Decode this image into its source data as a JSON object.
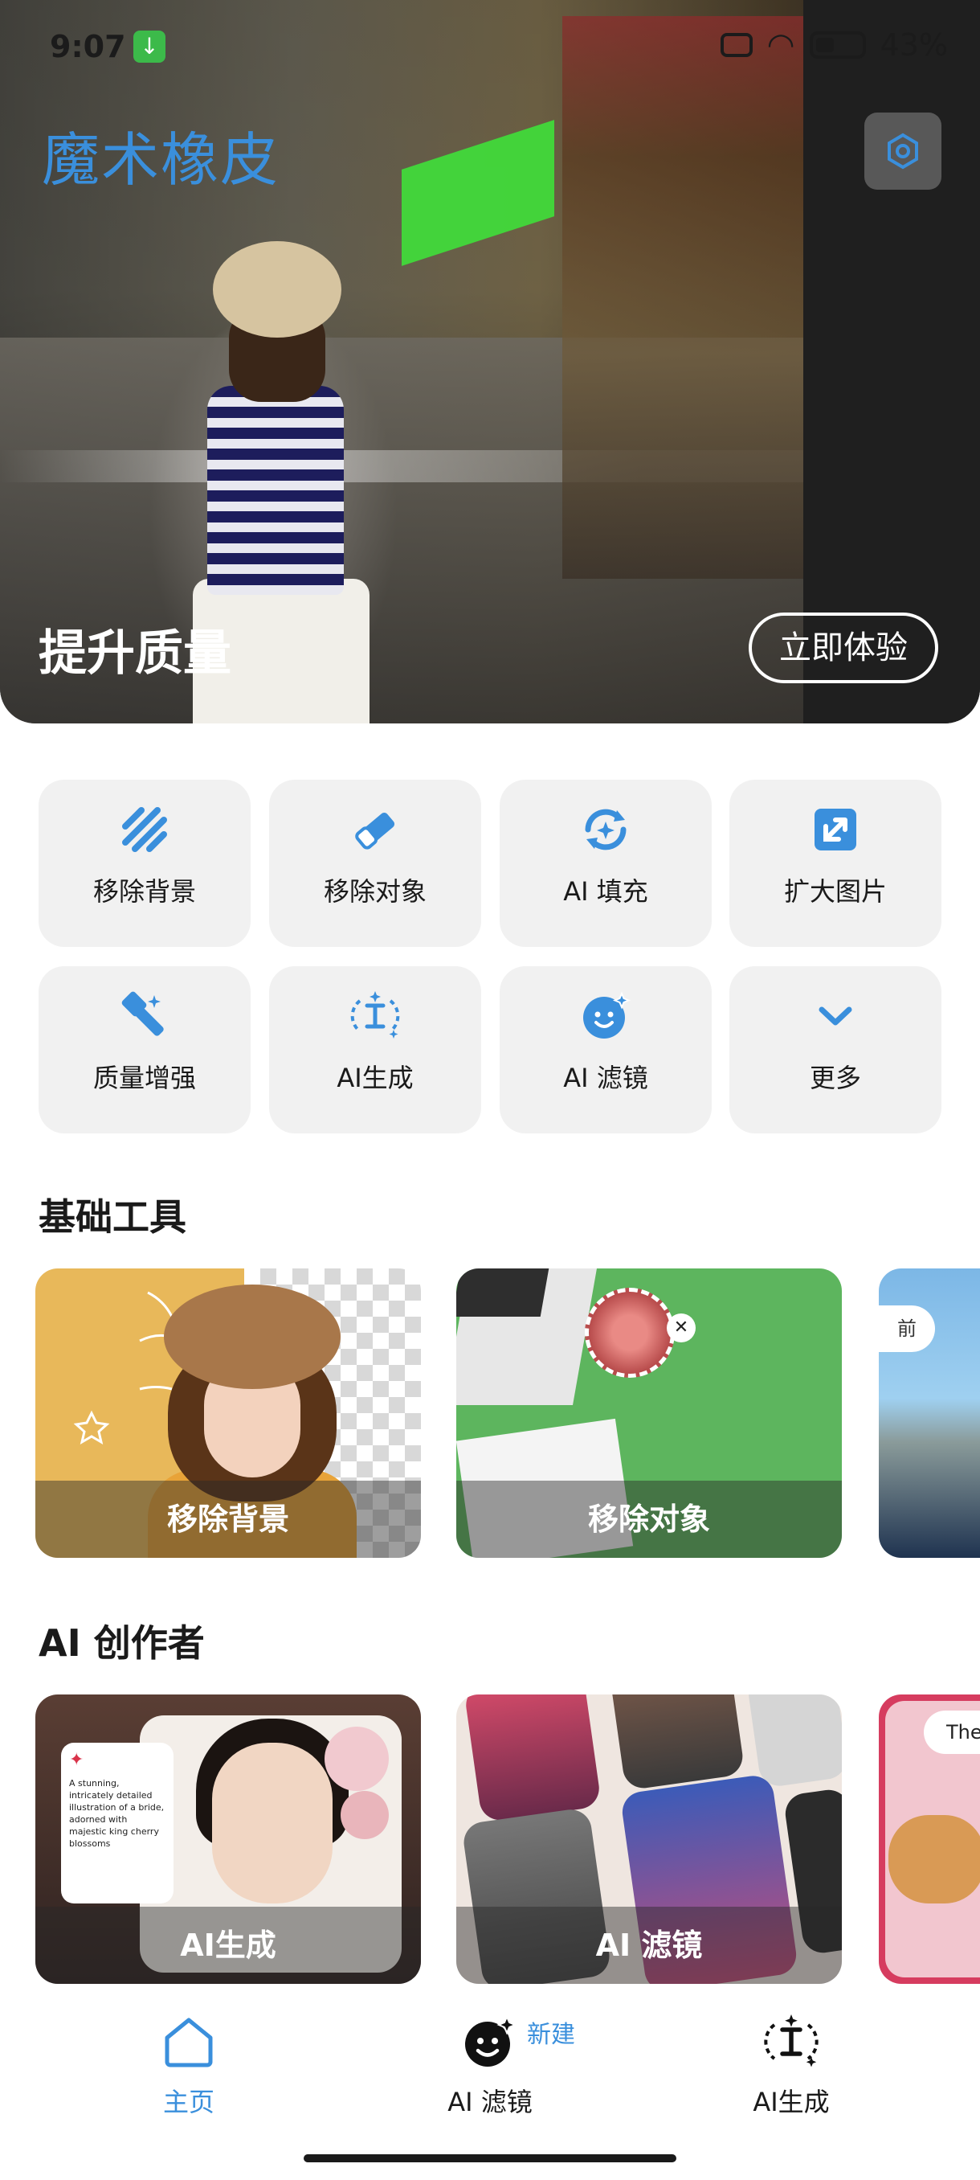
{
  "status_bar": {
    "time": "9:07",
    "battery": "43%"
  },
  "app": {
    "title": "魔术橡皮"
  },
  "hero": {
    "caption": "提升质量",
    "cta": "立即体验"
  },
  "tools": [
    {
      "label": "移除背景",
      "icon": "stripes-icon"
    },
    {
      "label": "移除对象",
      "icon": "eraser-icon"
    },
    {
      "label": "AI 填充",
      "icon": "ai-fill-icon"
    },
    {
      "label": "扩大图片",
      "icon": "expand-image-icon"
    },
    {
      "label": "质量增强",
      "icon": "magic-wand-icon"
    },
    {
      "label": "AI生成",
      "icon": "text-cursor-sparkle-icon"
    },
    {
      "label": "AI 滤镜",
      "icon": "face-sparkle-icon"
    },
    {
      "label": "更多",
      "icon": "chevron-down-icon"
    }
  ],
  "basic_tools": {
    "title": "基础工具",
    "cards": [
      {
        "label": "移除背景"
      },
      {
        "label": "移除对象"
      },
      {
        "badge": "前"
      }
    ]
  },
  "ai_creator": {
    "title": "AI 创作者",
    "cards": [
      {
        "label": "AI生成",
        "prompt": "A stunning, intricately detailed illustration of a bride, adorned with majestic king cherry blossoms"
      },
      {
        "label": "AI 滤镜"
      },
      {
        "bubble": "The"
      }
    ]
  },
  "bottom_nav": {
    "items": [
      {
        "label": "主页",
        "icon": "home-icon",
        "active": true
      },
      {
        "label": "AI 滤镜",
        "icon": "face-sparkle-icon",
        "badge": "新建"
      },
      {
        "label": "AI生成",
        "icon": "text-cursor-sparkle-icon"
      }
    ]
  },
  "colors": {
    "accent": "#3a8fdc",
    "tile_bg": "#f1f1f1"
  }
}
